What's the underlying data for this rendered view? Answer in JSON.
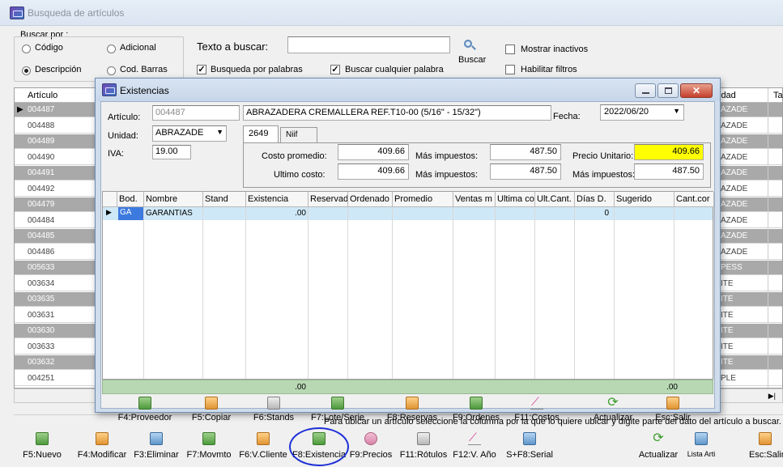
{
  "main": {
    "title": "Busqueda de artículos",
    "search_by_label": "Buscar por :",
    "radios": [
      {
        "label": "Código",
        "selected": false
      },
      {
        "label": "Adicional",
        "selected": false
      },
      {
        "label": "Descripción",
        "selected": true
      },
      {
        "label": "Cod. Barras",
        "selected": false
      }
    ],
    "search_text_label": "Texto a buscar:",
    "search_value": "",
    "search_button": "Buscar",
    "checks": {
      "busqueda_palabras": {
        "label": "Busqueda por palabras",
        "checked": true
      },
      "cualquier_palabra": {
        "label": "Buscar cualquier palabra",
        "checked": true
      },
      "mostrar_inactivos": {
        "label": "Mostrar inactivos",
        "checked": false
      },
      "habilitar_filtros": {
        "label": "Habilitar filtros",
        "checked": false
      }
    },
    "grid": {
      "col_articulo": "Artículo",
      "col_unidad": "idad",
      "col_t": "Ta",
      "rows": [
        {
          "articulo": "004487",
          "unidad": "AZADE",
          "gray": true,
          "current": true
        },
        {
          "articulo": "004488",
          "unidad": "AZADE",
          "gray": false
        },
        {
          "articulo": "004489",
          "unidad": "AZADE",
          "gray": true
        },
        {
          "articulo": "004490",
          "unidad": "AZADE",
          "gray": false
        },
        {
          "articulo": "004491",
          "unidad": "AZADE",
          "gray": true
        },
        {
          "articulo": "004492",
          "unidad": "AZADE",
          "gray": false
        },
        {
          "articulo": "004479",
          "unidad": "AZADE",
          "gray": true
        },
        {
          "articulo": "004484",
          "unidad": "AZADE",
          "gray": false
        },
        {
          "articulo": "004485",
          "unidad": "AZADE",
          "gray": true
        },
        {
          "articulo": "004486",
          "unidad": "AZADE",
          "gray": false
        },
        {
          "articulo": "005633",
          "unidad": "PESS",
          "gray": true
        },
        {
          "articulo": "003634",
          "unidad": "ITE",
          "gray": false
        },
        {
          "articulo": "003635",
          "unidad": "ITE",
          "gray": true
        },
        {
          "articulo": "003631",
          "unidad": "ITE",
          "gray": false
        },
        {
          "articulo": "003630",
          "unidad": "ITE",
          "gray": true
        },
        {
          "articulo": "003633",
          "unidad": "ITE",
          "gray": false
        },
        {
          "articulo": "003632",
          "unidad": "ITE",
          "gray": true
        },
        {
          "articulo": "004251",
          "unidad": "PLE",
          "gray": false
        }
      ]
    },
    "status_text": "Para ubicar un artículo seleccione la columna por la que lo quiere ubicar y digite parte del dato del artículo a buscar.",
    "toolbar": [
      {
        "label": "F5:Nuevo",
        "icon": "new-icon"
      },
      {
        "label": "F4:Modificar",
        "icon": "edit-icon"
      },
      {
        "label": "F3:Eliminar",
        "icon": "delete-icon"
      },
      {
        "label": "F7:Movmto",
        "icon": "movement-icon"
      },
      {
        "label": "F6:V.Cliente",
        "icon": "client-icon"
      },
      {
        "label": "F8:Existencia",
        "icon": "stock-icon"
      },
      {
        "label": "F9:Precios",
        "icon": "price-tag-icon"
      },
      {
        "label": "F11:Rótulos",
        "icon": "printer-icon"
      },
      {
        "label": "F12:V. Año",
        "icon": "chart-icon"
      },
      {
        "label": "S+F8:Serial",
        "icon": "calendar-icon"
      },
      {
        "label": "Actualizar",
        "icon": "refresh-icon"
      },
      {
        "label": "Lista Arti",
        "icon": "list-icon"
      },
      {
        "label": "Esc:Salir",
        "icon": "exit-icon"
      }
    ],
    "highlight_color": "#1c2fd6"
  },
  "dialog": {
    "title": "Existencias",
    "articulo_label": "Artículo:",
    "articulo_code": "004487",
    "articulo_desc": "ABRAZADERA CREMALLERA REF.T10-00 (5/16\" - 15/32\")",
    "fecha_label": "Fecha:",
    "fecha_value": "2022/06/20",
    "unidad_label": "Unidad:",
    "unidad_value": "ABRAZADE",
    "iva_label": "IVA:",
    "iva_value": "19.00",
    "tabs": [
      "2649",
      "Niif"
    ],
    "costo_promedio_label": "Costo promedio:",
    "costo_promedio": "409.66",
    "ultimo_costo_label": "Ultimo costo:",
    "ultimo_costo": "409.66",
    "mas_impuestos_label": "Más impuestos:",
    "mas_impuestos_1": "487.50",
    "mas_impuestos_2": "487.50",
    "precio_unitario_label": "Precio Unitario:",
    "precio_unitario": "409.66",
    "precio_mas_impuestos": "487.50",
    "precio_color": "#ffff00",
    "grid": {
      "headers": [
        "Bod.",
        "Nombre",
        "Stand",
        "Existencia",
        "Reservad",
        "Ordenado",
        "Promedio",
        "Ventas m",
        "Ultima co",
        "Ult.Cant.",
        "Días D.",
        "Sugerido",
        "Cant.cor"
      ],
      "row": {
        "bod": "GA",
        "nombre": "GARANTIAS",
        "existencia": ".00",
        "dias": "0"
      },
      "total_existencia": ".00",
      "total_sugerido": ".00"
    },
    "toolbar": [
      {
        "label": "F4:Proveedor",
        "icon": "supplier-icon"
      },
      {
        "label": "F5:Copiar",
        "icon": "copy-icon"
      },
      {
        "label": "F6:Stands",
        "icon": "stands-icon"
      },
      {
        "label": "F7:Lote/Serie",
        "icon": "lot-icon"
      },
      {
        "label": "F8:Reservas",
        "icon": "reservations-icon"
      },
      {
        "label": "F9:Ordenes",
        "icon": "orders-icon"
      },
      {
        "label": "F11:Costos",
        "icon": "costs-chart-icon"
      },
      {
        "label": "Actualizar",
        "icon": "refresh-icon"
      },
      {
        "label": "Esc:Salir",
        "icon": "exit-icon"
      }
    ]
  }
}
